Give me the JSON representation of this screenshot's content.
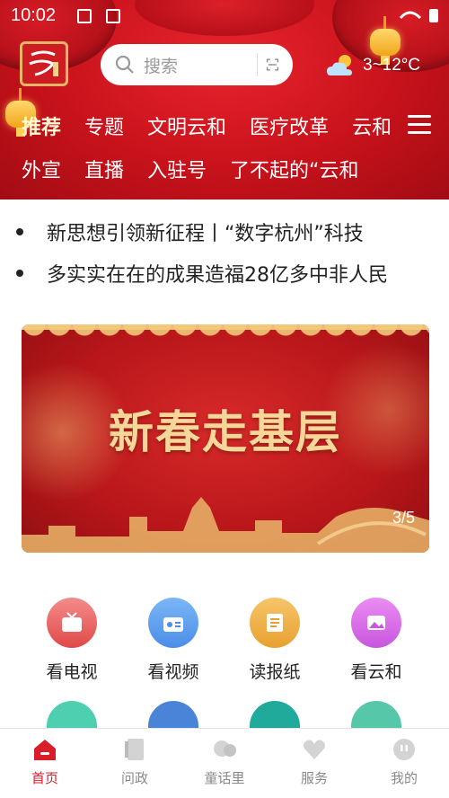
{
  "status_bar": {
    "time": "10:02"
  },
  "header": {
    "search_placeholder": "搜索",
    "weather": {
      "icon": "partly-cloudy-icon",
      "temperature": "3~12°C"
    },
    "tabs_row1": [
      "推荐",
      "专题",
      "文明云和",
      "医疗改革",
      "云和"
    ],
    "tabs_row2": [
      "外宣",
      "直播",
      "入驻号",
      "了不起的“云和"
    ],
    "active_tab": "推荐"
  },
  "ticker": [
    "新思想引领新征程丨“数字杭州”科技",
    "多实实在在的成果造福28亿多中非人民"
  ],
  "banner": {
    "headline": "新春走基层",
    "pager": "3/5"
  },
  "quick_links": [
    {
      "label": "看电视",
      "icon": "tv-icon",
      "color": "#f06a6a"
    },
    {
      "label": "看视频",
      "icon": "radio-icon",
      "color": "#5b9ff0"
    },
    {
      "label": "读报纸",
      "icon": "newspaper-icon",
      "color": "#f0b24a"
    },
    {
      "label": "看云和",
      "icon": "picture-icon",
      "color": "#d868e6"
    }
  ],
  "tab_bar": [
    {
      "label": "首页",
      "icon": "home-icon",
      "active": true
    },
    {
      "label": "问政",
      "icon": "document-icon",
      "active": false
    },
    {
      "label": "童话里",
      "icon": "bubble-icon",
      "active": false
    },
    {
      "label": "服务",
      "icon": "heart-icon",
      "active": false
    },
    {
      "label": "我的",
      "icon": "profile-icon",
      "active": false
    }
  ],
  "colors": {
    "accent": "#d81e2a",
    "header_red": "#c8121b",
    "gold": "#f6d79a"
  }
}
